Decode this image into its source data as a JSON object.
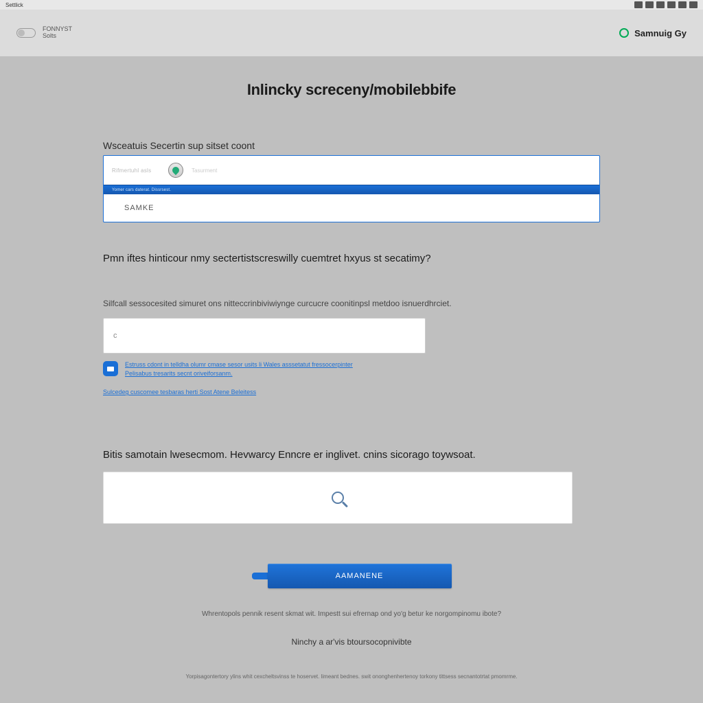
{
  "sysbar": {
    "left_label": "Settlick"
  },
  "header": {
    "left_line1": "FONNYST",
    "left_line2": "Solts",
    "right_brand": "Samnuig Gy"
  },
  "page_title": "Inlincky screceny/mobilebbife",
  "account": {
    "label": "Wsceatuis Secertin sup sitset coont",
    "tiny_left": "Rifmertuhl asls",
    "placeholder": "Tasurment",
    "blue_strip": "Yomer cars daterat. Dissrsest.",
    "selected": "SAMKE"
  },
  "question": "Pmn iftes hinticour nmy sectertistscreswilly cuemtret hxyus st secatimy?",
  "subtext": "Silfcall sessocesited simuret ons nitteccrinbiviwiynge curcucre coonitinpsl metdoo isnuerdhrciet.",
  "small_input_value": "c",
  "info": {
    "line1": "Estruss cdont in telldha olumr cmase sesor usits li Wales asssetatut fressocerpinter",
    "line2": "Pelisabus tresarits secnt oriveiforsanm."
  },
  "sub_link": "Sulcedeg cuscomee tesbaras herti Sost Atene Beleitess",
  "big_text": "Bitis samotain lwesecmom. Hevwarcy Enncre er inglivet. cnins sicorago toywsoat.",
  "cta_label": "AAMANENE",
  "foot1": "Whrentopols pennik resent skmat wit. Impestt sui efrernap ond yo'g betur ke norgompinomu ibote?",
  "foot2": "Ninchy a ar'vis btoursocopnivibte",
  "foot3": "Yorpisagontertory ylins whit cexcheltsvinss te hoservet. limeant bednes. swit ononghenhertenoy torkony tittsess secnantotrtat pmomrme."
}
